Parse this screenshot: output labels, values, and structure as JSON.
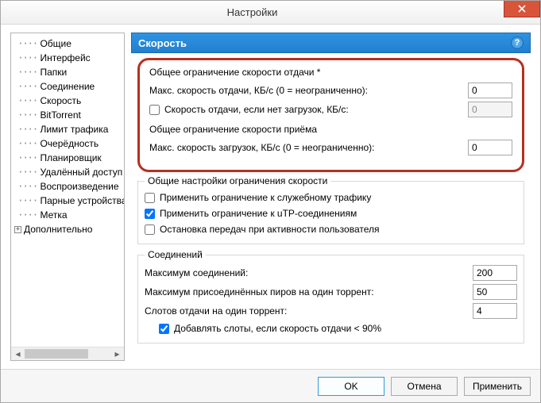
{
  "window": {
    "title": "Настройки"
  },
  "sidebar": {
    "items": [
      {
        "label": "Общие"
      },
      {
        "label": "Интерфейс"
      },
      {
        "label": "Папки"
      },
      {
        "label": "Соединение"
      },
      {
        "label": "Скорость"
      },
      {
        "label": "BitTorrent"
      },
      {
        "label": "Лимит трафика"
      },
      {
        "label": "Очерёдность"
      },
      {
        "label": "Планировщик"
      },
      {
        "label": "Удалённый доступ"
      },
      {
        "label": "Воспроизведение"
      },
      {
        "label": "Парные устройства"
      },
      {
        "label": "Метка"
      }
    ],
    "expandable": {
      "label": "Дополнительно"
    }
  },
  "section": {
    "title": "Скорость"
  },
  "group_upload": {
    "legend": "Общее ограничение скорости отдачи *",
    "max_label": "Макс. скорость отдачи, КБ/с (0 = неограниченно):",
    "max_value": "0",
    "alt_label": "Скорость отдачи, если нет загрузок, КБ/с:",
    "alt_value": "0",
    "alt_checked": false
  },
  "group_download": {
    "legend": "Общее ограничение скорости приёма",
    "max_label": "Макс. скорость загрузок, КБ/с (0 = неограниченно):",
    "max_value": "0"
  },
  "group_general": {
    "legend": "Общие настройки ограничения скорости",
    "opt1_label": "Применить ограничение к служебному трафику",
    "opt1_checked": false,
    "opt2_label": "Применить ограничение к uTP-соединениям",
    "opt2_checked": true,
    "opt3_label": "Остановка передач при активности пользователя",
    "opt3_checked": false
  },
  "group_conn": {
    "legend": "Соединений",
    "row1_label": "Максимум соединений:",
    "row1_value": "200",
    "row2_label": "Максимум присоединённых пиров на один торрент:",
    "row2_value": "50",
    "row3_label": "Слотов отдачи на один торрент:",
    "row3_value": "4",
    "opt1_label": "Добавлять слоты, если скорость отдачи < 90%",
    "opt1_checked": true
  },
  "footer": {
    "ok": "OK",
    "cancel": "Отмена",
    "apply": "Применить"
  }
}
